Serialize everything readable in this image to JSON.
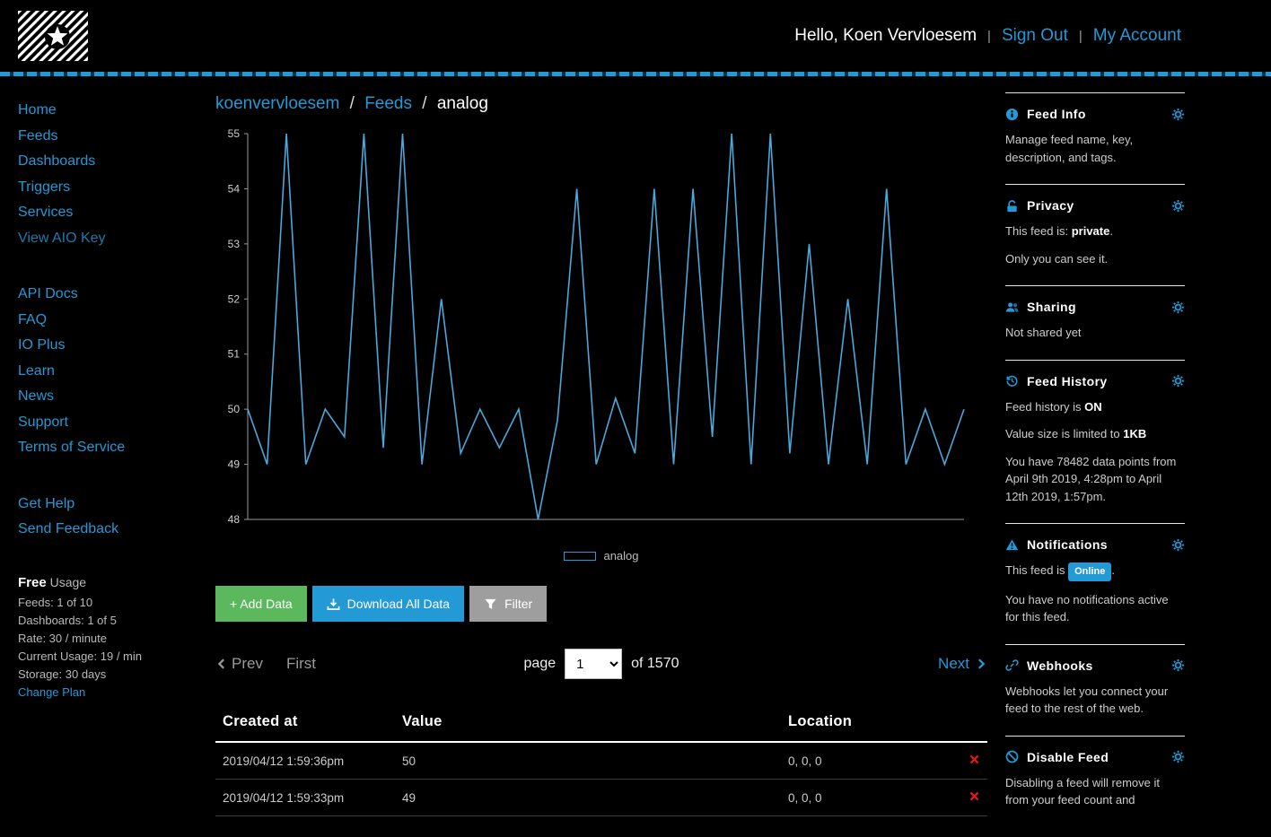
{
  "header": {
    "greeting": "Hello, Koen Vervloesem",
    "separator": "|",
    "sign_out": "Sign Out",
    "my_account": "My Account"
  },
  "sidebar": {
    "primary": [
      "Home",
      "Feeds",
      "Dashboards",
      "Triggers",
      "Services",
      "View AIO Key"
    ],
    "secondary": [
      "API Docs",
      "FAQ",
      "IO Plus",
      "Learn",
      "News",
      "Support",
      "Terms of Service"
    ],
    "tertiary": [
      "Get Help",
      "Send Feedback"
    ],
    "usage": {
      "plan": "Free",
      "usage_label": " Usage",
      "lines": [
        "Feeds: 1 of 10",
        "Dashboards: 1 of 5",
        "Rate: 30 / minute",
        "Current Usage: 19 / min",
        "Storage: 30 days"
      ],
      "change_plan": "Change Plan"
    }
  },
  "breadcrumb": {
    "user": "koenvervloesem",
    "sep": "/",
    "feeds": "Feeds",
    "current": "analog"
  },
  "chart_data": {
    "type": "line",
    "series_name": "analog",
    "values": [
      50,
      49,
      55,
      49,
      50,
      49.5,
      55,
      49.3,
      55,
      49,
      52,
      49.2,
      50,
      49.3,
      50,
      48,
      49.8,
      54,
      49,
      50.2,
      49.2,
      54,
      49,
      54,
      49.5,
      55,
      49,
      55,
      49.2,
      53,
      49,
      52,
      49,
      54,
      49,
      50,
      49,
      50
    ],
    "ylim": [
      48,
      55
    ],
    "yticks": [
      48,
      49,
      50,
      51,
      52,
      53,
      54,
      55
    ],
    "xlabel": "",
    "ylabel": "",
    "grid": false,
    "legend_position": "bottom",
    "legend_label": "analog"
  },
  "legend": {
    "label": "analog"
  },
  "actions": {
    "add_data": "+ Add Data",
    "download": "Download All Data",
    "filter": "Filter"
  },
  "pagination": {
    "prev": "Prev",
    "first": "First",
    "page_label": "page",
    "page_value": "1",
    "of": "of 1570",
    "next": "Next"
  },
  "table": {
    "headers": [
      "Created at",
      "Value",
      "Location"
    ],
    "rows": [
      {
        "created": "2019/04/12 1:59:36pm",
        "value": "50",
        "location": "0, 0, 0"
      },
      {
        "created": "2019/04/12 1:59:33pm",
        "value": "49",
        "location": "0, 0, 0"
      }
    ]
  },
  "panel": {
    "feed_info": {
      "title": "Feed Info",
      "body": "Manage feed name, key, description, and tags."
    },
    "privacy": {
      "title": "Privacy",
      "prefix": "This feed is: ",
      "value": "private",
      "suffix": ".",
      "note": "Only you can see it."
    },
    "sharing": {
      "title": "Sharing",
      "body": "Not shared yet"
    },
    "feed_history": {
      "title": "Feed History",
      "line1_prefix": "Feed history is ",
      "line1_value": "ON",
      "line2_prefix": "Value size is limited to ",
      "line2_value": "1KB",
      "line3": "You have 78482 data points from April 9th 2019, 4:28pm to April 12th 2019, 1:57pm."
    },
    "notifications": {
      "title": "Notifications",
      "line1_prefix": "This feed is ",
      "badge": "Online",
      "line1_suffix": ".",
      "line2": "You have no notifications active for this feed."
    },
    "webhooks": {
      "title": "Webhooks",
      "body": "Webhooks let you connect your feed to the rest of the web."
    },
    "disable": {
      "title": "Disable Feed",
      "body": "Disabling a feed will remove it from your feed count and"
    }
  },
  "colors": {
    "accent": "#2399d5",
    "chart_line": "#4aa8dc",
    "green_button": "#5cb85c",
    "grey_button": "#9e9e9e",
    "delete_red": "#e01a1a",
    "online_badge": "#2399d5"
  }
}
